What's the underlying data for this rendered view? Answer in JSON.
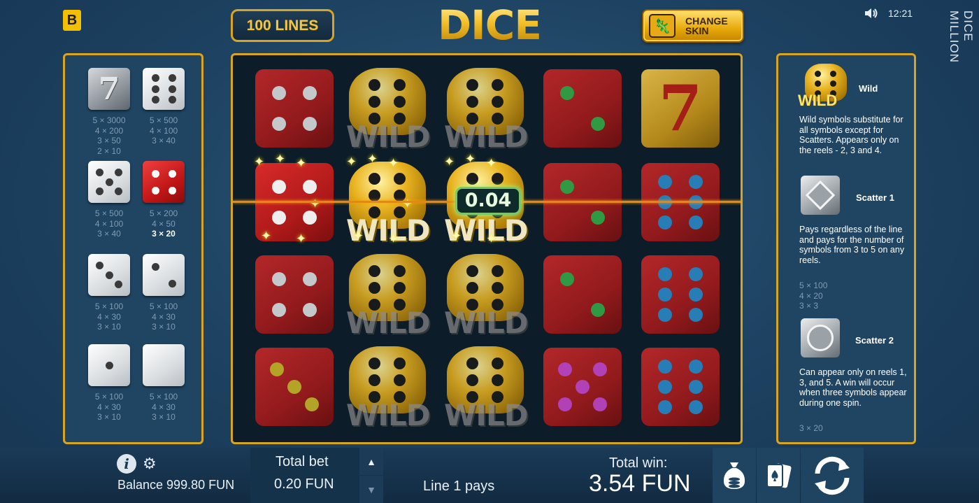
{
  "header": {
    "logo_letter": "B",
    "lines_label": "100 LINES",
    "title": "DICE MILLION",
    "skin_label_1": "CHANGE",
    "skin_label_2": "SKIN",
    "clock": "12:21",
    "vertical_title": "DICE MILLION"
  },
  "paytable": [
    {
      "symbol": "silver-seven",
      "pays": [
        "5 × 3000",
        "4 × 200",
        "3 × 50",
        "2 × 10"
      ],
      "highlight": []
    },
    {
      "symbol": "white-six",
      "pays": [
        "5 × 500",
        "4 × 100",
        "3 × 40"
      ],
      "highlight": []
    },
    {
      "symbol": "white-five",
      "pays": [
        "5 × 500",
        "4 × 100",
        "3 × 40"
      ],
      "highlight": []
    },
    {
      "symbol": "red-four",
      "pays": [
        "5 × 200",
        "4 × 50",
        "3 × 20"
      ],
      "highlight": [
        2
      ]
    },
    {
      "symbol": "white-three",
      "pays": [
        "5 × 100",
        "4 × 30",
        "3 × 10"
      ],
      "highlight": []
    },
    {
      "symbol": "white-two",
      "pays": [
        "5 × 100",
        "4 × 30",
        "3 × 10"
      ],
      "highlight": []
    },
    {
      "symbol": "white-one",
      "pays": [
        "5 × 100",
        "4 × 30",
        "3 × 10"
      ],
      "highlight": []
    },
    {
      "symbol": "white-blank",
      "pays": [
        "5 × 100",
        "4 × 30",
        "3 × 10"
      ],
      "highlight": []
    }
  ],
  "reels": {
    "wild_text": "WILD",
    "win_amount": "0.04"
  },
  "info": {
    "wild_badge": "WILD",
    "wild_title": "Wild",
    "wild_text": "Wild symbols substitute for all symbols except for Scatters. Appears only on the reels - 2, 3 and 4.",
    "scatter1_title": "Scatter 1",
    "scatter1_text": "Pays regardless of the line and pays for the number of symbols from 3 to 5 on any reels.",
    "scatter1_pays": [
      "5 × 100",
      "4 × 20",
      "3 × 3"
    ],
    "scatter2_title": "Scatter 2",
    "scatter2_text": "Can appear only on reels 1, 3, and 5. A win will occur when three symbols appear during one spin.",
    "scatter2_pays": [
      "3 × 20"
    ]
  },
  "bottom": {
    "balance": "Balance 999.80 FUN",
    "bet_label": "Total bet",
    "bet_value": "0.20 FUN",
    "line_pays": "Line 1 pays",
    "win_label": "Total win:",
    "win_value": "3.54 FUN"
  },
  "colors": {
    "gold": "#d9a520",
    "background": "#1d4160",
    "die_red": "#c11616",
    "payline": "#e5861a"
  }
}
